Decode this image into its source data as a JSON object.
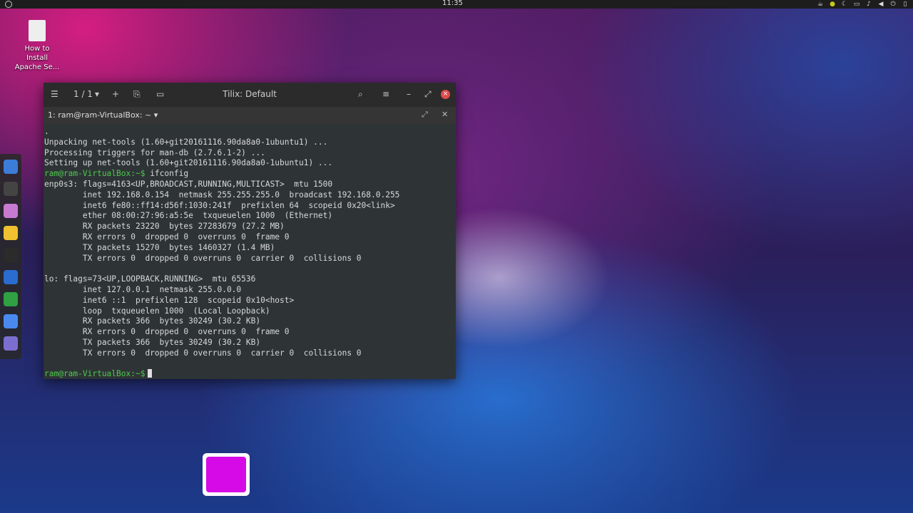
{
  "topbar": {
    "clock": "11:35"
  },
  "desktop": {
    "icon_label": "How to Install Apache Se..."
  },
  "window": {
    "title": "Tilix: Default",
    "session_counter": "1 / 1",
    "tab_title": "1: ram@ram-VirtualBox: ~"
  },
  "terminal": {
    "lines": [
      ".",
      "Unpacking net-tools (1.60+git20161116.90da8a0-1ubuntu1) ...",
      "Processing triggers for man-db (2.7.6.1-2) ...",
      "Setting up net-tools (1.60+git20161116.90da8a0-1ubuntu1) ..."
    ],
    "prompt": "ram@ram-VirtualBox:~$",
    "command": " ifconfig",
    "output": [
      "enp0s3: flags=4163<UP,BROADCAST,RUNNING,MULTICAST>  mtu 1500",
      "        inet 192.168.0.154  netmask 255.255.255.0  broadcast 192.168.0.255",
      "        inet6 fe80::ff14:d56f:1030:241f  prefixlen 64  scopeid 0x20<link>",
      "        ether 08:00:27:96:a5:5e  txqueuelen 1000  (Ethernet)",
      "        RX packets 23220  bytes 27283679 (27.2 MB)",
      "        RX errors 0  dropped 0  overruns 0  frame 0",
      "        TX packets 15270  bytes 1460327 (1.4 MB)",
      "        TX errors 0  dropped 0 overruns 0  carrier 0  collisions 0",
      "",
      "lo: flags=73<UP,LOOPBACK,RUNNING>  mtu 65536",
      "        inet 127.0.0.1  netmask 255.0.0.0",
      "        inet6 ::1  prefixlen 128  scopeid 0x10<host>",
      "        loop  txqueuelen 1000  (Local Loopback)",
      "        RX packets 366  bytes 30249 (30.2 KB)",
      "        RX errors 0  dropped 0  overruns 0  frame 0",
      "        TX packets 366  bytes 30249 (30.2 KB)",
      "        TX errors 0  dropped 0 overruns 0  carrier 0  collisions 0",
      ""
    ],
    "final_prompt": "ram@ram-VirtualBox:~$"
  },
  "dock": {
    "items": [
      {
        "icon": "browser-icon",
        "color": "#3b7dd8"
      },
      {
        "icon": "soccer-icon",
        "color": "#444444"
      },
      {
        "icon": "files-icon",
        "color": "#c87ad0"
      },
      {
        "icon": "music-icon",
        "color": "#f0c030"
      },
      {
        "icon": "terminal-icon",
        "color": "#2b2b2b"
      },
      {
        "icon": "writer-icon",
        "color": "#2a6ccf"
      },
      {
        "icon": "calc-icon",
        "color": "#2fa043"
      },
      {
        "icon": "chrome-icon",
        "color": "#4a8af0"
      },
      {
        "icon": "notes-icon",
        "color": "#7a6fd0"
      }
    ]
  },
  "colors": {
    "prompt": "#4ec94e",
    "accent_tile": "#d60ae6"
  }
}
